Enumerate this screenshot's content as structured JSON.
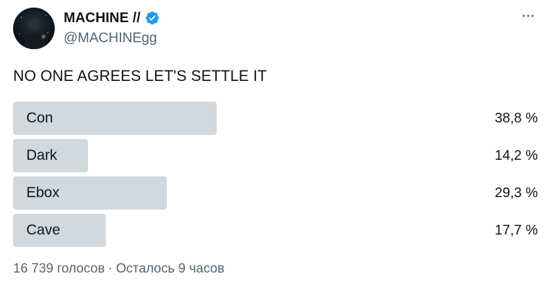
{
  "author": {
    "display_name": "MACHINE //",
    "handle": "@MACHINEgg",
    "verified": true,
    "verified_color": "#1d9bf0"
  },
  "icons": {
    "verified": "verified-badge-icon",
    "more": "more-horizontal-icon"
  },
  "tweet": {
    "text": "NO ONE AGREES LET'S SETTLE IT"
  },
  "poll": {
    "options": [
      {
        "label": "Con",
        "percent_text": "38,8 %",
        "percent": 38.8
      },
      {
        "label": "Dark",
        "percent_text": "14,2 %",
        "percent": 14.2
      },
      {
        "label": "Ebox",
        "percent_text": "29,3 %",
        "percent": 29.3
      },
      {
        "label": "Cave",
        "percent_text": "17,7 %",
        "percent": 17.7
      }
    ],
    "votes_text": "16 739 голосов",
    "separator": "·",
    "time_left_text": "Осталось 9 часов",
    "bar_color": "#cfd9de"
  }
}
